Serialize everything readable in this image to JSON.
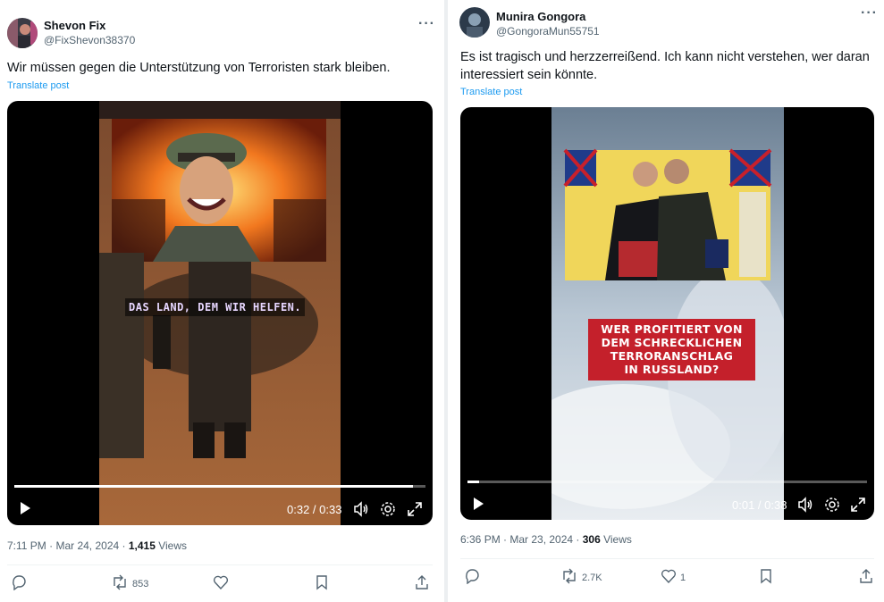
{
  "posts": [
    {
      "author": {
        "name": "Shevon Fix",
        "handle": "@FixShevon38370"
      },
      "text": "Wir müssen gegen die Unterstützung von Terroristen stark bleiben.",
      "translate_label": "Translate post",
      "video": {
        "caption": "DAS LAND, DEM WIR HELFEN.",
        "time": "0:32 / 0:33",
        "progress": 0.97
      },
      "timestamp": "7:11 PM · Mar 24, 2024 · ",
      "views_count": "1,415",
      "views_label": " Views",
      "actions": {
        "replies": "",
        "reposts": "853",
        "likes": "",
        "bookmarks": ""
      }
    },
    {
      "author": {
        "name": "Munira Gongora",
        "handle": "@GongoraMun55751"
      },
      "text_line1": "Es ist tragisch und herzzerreißend. Ich kann nicht verstehen, wer daran",
      "text_line2": "interessiert sein könnte.",
      "translate_label": "Translate post",
      "video": {
        "overlay_lines": [
          "WER PROFITIERT VON",
          "DEM SCHRECKLICHEN",
          "TERRORANSCHLAG",
          "IN RUSSLAND?"
        ],
        "time": "0:01 / 0:38",
        "progress": 0.03
      },
      "timestamp": "6:36 PM · Mar 23, 2024 · ",
      "views_count": "306",
      "views_label": " Views",
      "actions": {
        "replies": "",
        "reposts": "2.7K",
        "likes": "1",
        "bookmarks": ""
      }
    }
  ],
  "colors": {
    "accent": "#1d9bf0",
    "secondary_text": "#536471",
    "overlay_red": "#c4202b"
  },
  "icons": [
    "more-icon",
    "play-icon",
    "volume-icon",
    "settings-icon",
    "fullscreen-icon",
    "reply-icon",
    "repost-icon",
    "like-icon",
    "bookmark-icon",
    "share-icon"
  ]
}
